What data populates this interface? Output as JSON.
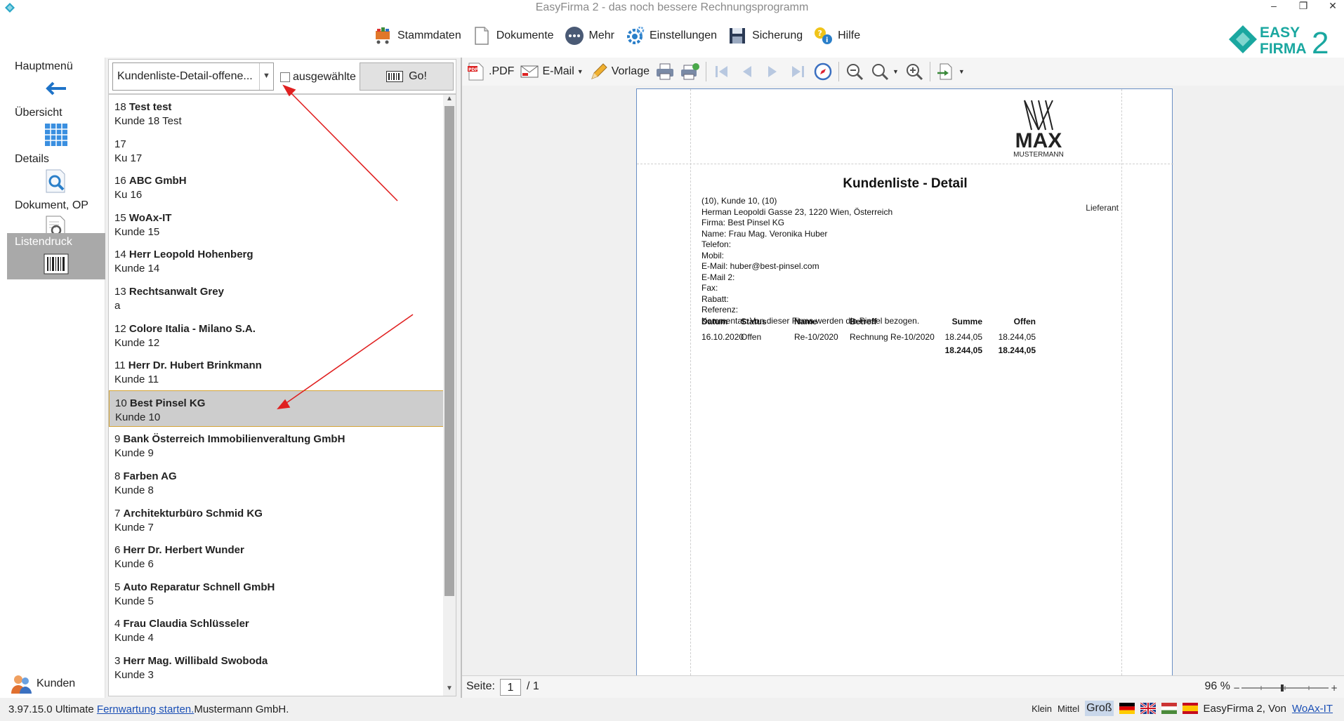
{
  "window": {
    "title": "EasyFirma 2 - das noch bessere Rechnungsprogramm"
  },
  "menu": {
    "items": [
      {
        "label": "Stammdaten",
        "icon": "cart-icon"
      },
      {
        "label": "Dokumente",
        "icon": "document-icon"
      },
      {
        "label": "Mehr",
        "icon": "more-icon"
      },
      {
        "label": "Einstellungen",
        "icon": "gear-icon"
      },
      {
        "label": "Sicherung",
        "icon": "floppy-icon"
      },
      {
        "label": "Hilfe",
        "icon": "help-icon"
      }
    ],
    "logo": {
      "line1": "EASY",
      "line2": "FIRMA",
      "number": "2"
    }
  },
  "leftnav": {
    "items": [
      {
        "label": "Hauptmenü",
        "icon": "back-arrow-icon",
        "active": false
      },
      {
        "label": "Übersicht",
        "icon": "calendar-grid-icon",
        "active": false
      },
      {
        "label": "Details",
        "icon": "magnifier-icon",
        "active": false
      },
      {
        "label": "Dokument, OP",
        "icon": "document-search-icon",
        "active": false
      },
      {
        "label": "Listendruck",
        "icon": "barcode-icon",
        "active": true
      }
    ],
    "bottom": {
      "label": "Kunden",
      "icon": "users-icon"
    }
  },
  "list": {
    "report_select": "Kundenliste-Detail-offene...",
    "checkbox_label": "ausgewählte",
    "go_label": "Go!",
    "rows": [
      {
        "num": "18",
        "name": "Test test",
        "sub": "Kunde 18 Test"
      },
      {
        "num": "17",
        "name": "",
        "sub": "Ku 17"
      },
      {
        "num": "16",
        "name": "ABC GmbH",
        "sub": "Ku 16"
      },
      {
        "num": "15",
        "name": "WoAx-IT",
        "sub": "Kunde 15"
      },
      {
        "num": "14",
        "name": "Herr Leopold Hohenberg",
        "sub": "Kunde 14"
      },
      {
        "num": "13",
        "name": "Rechtsanwalt Grey",
        "sub": "a"
      },
      {
        "num": "12",
        "name": "Colore Italia - Milano S.A.",
        "sub": "Kunde 12"
      },
      {
        "num": "11",
        "name": "Herr Dr. Hubert Brinkmann",
        "sub": "Kunde 11"
      },
      {
        "num": "10",
        "name": "Best Pinsel KG",
        "sub": "Kunde 10",
        "selected": true
      },
      {
        "num": "9",
        "name": "Bank Österreich Immobilienveraltung GmbH",
        "sub": "Kunde 9"
      },
      {
        "num": "8",
        "name": "Farben AG",
        "sub": "Kunde 8"
      },
      {
        "num": "7",
        "name": "Architekturbüro Schmid KG",
        "sub": "Kunde 7"
      },
      {
        "num": "6",
        "name": "Herr Dr. Herbert Wunder",
        "sub": "Kunde 6"
      },
      {
        "num": "5",
        "name": "Auto Reparatur Schnell GmbH",
        "sub": "Kunde 5"
      },
      {
        "num": "4",
        "name": "Frau Claudia Schlüsseler",
        "sub": "Kunde 4"
      },
      {
        "num": "3",
        "name": "Herr Mag. Willibald Swoboda",
        "sub": "Kunde 3"
      }
    ]
  },
  "preview": {
    "toolbar": {
      "pdf": ".PDF",
      "email": "E-Mail",
      "vorlage": "Vorlage"
    },
    "doc": {
      "logo_big": "MAX",
      "logo_small": "MUSTERMANN",
      "title": "Kundenliste - Detail",
      "role": "Lieferant",
      "lines": [
        "(10), Kunde 10, (10)",
        "Herman Leopoldi Gasse 23, 1220 Wien, Österreich",
        "Firma: Best Pinsel KG",
        "Name: Frau Mag. Veronika Huber",
        "Telefon:",
        "Mobil:",
        "E-Mail: huber@best-pinsel.com",
        "E-Mail 2:",
        "Fax:",
        "Rabatt:",
        "Referenz:",
        "Kommentar: Von dieser Firma werden die Pinsel bezogen."
      ],
      "table": {
        "headers": [
          "Datum",
          "Status",
          "Name",
          "Betreff",
          "Summe",
          "Offen"
        ],
        "row": [
          "16.10.2020",
          "Offen",
          "Re-10/2020",
          "Rechnung Re-10/2020",
          "18.244,05",
          "18.244,05"
        ],
        "totals": [
          "18.244,05",
          "18.244,05"
        ]
      }
    },
    "status": {
      "page_label": "Seite:",
      "page": "1",
      "total": "/ 1",
      "zoom": "96 %"
    }
  },
  "statusbar": {
    "version": "3.97.15.0 Ultimate",
    "remote_link": "Fernwartung starten.",
    "company": "Mustermann GmbH.",
    "sizes": [
      "Klein",
      "Mittel",
      "Groß"
    ],
    "active_size": "Groß",
    "app_credit": "EasyFirma 2, Von",
    "credit_link": "WoAx-IT"
  }
}
